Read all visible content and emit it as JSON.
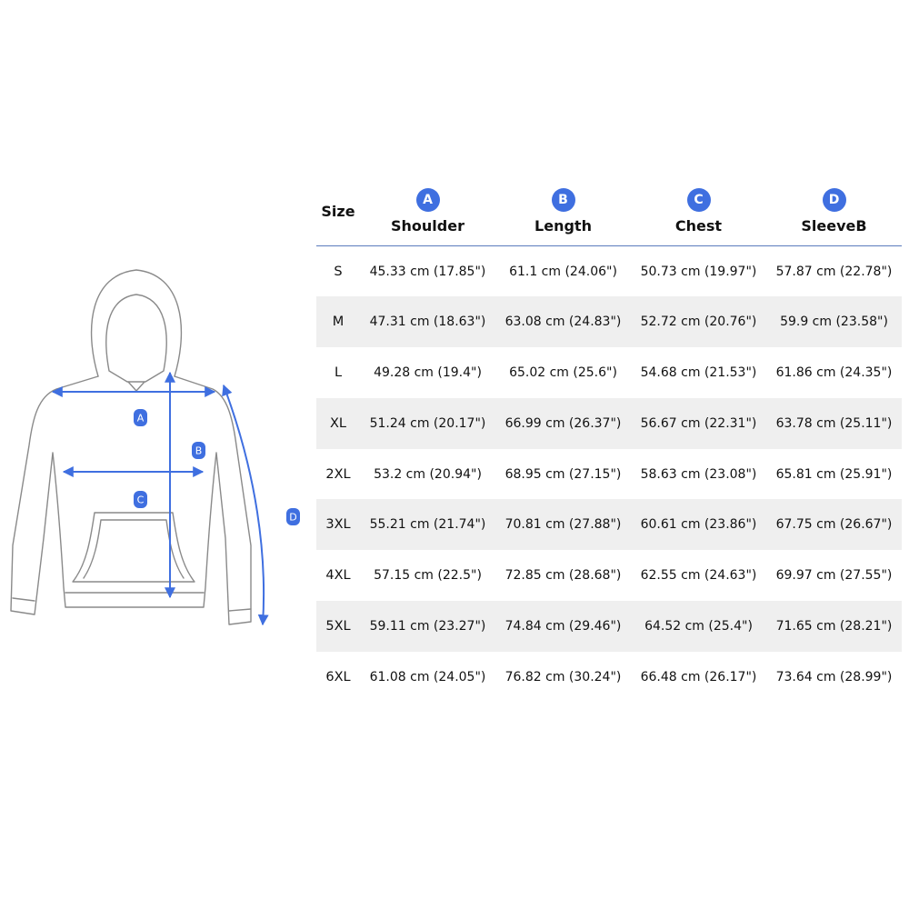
{
  "colors": {
    "accent": "#3f6fe0",
    "row_alt": "#efefef",
    "header_rule": "#5b7bbd"
  },
  "diagram": {
    "icon": "hoodie-outline-icon",
    "markers": {
      "a": "A",
      "b": "B",
      "c": "C",
      "d": "D"
    }
  },
  "table": {
    "size_header": "Size",
    "columns": [
      {
        "badge": "A",
        "label": "Shoulder"
      },
      {
        "badge": "B",
        "label": "Length"
      },
      {
        "badge": "C",
        "label": "Chest"
      },
      {
        "badge": "D",
        "label": "SleeveB"
      }
    ],
    "rows": [
      {
        "size": "S",
        "values": [
          "45.33 cm (17.85\")",
          "61.1 cm (24.06\")",
          "50.73 cm (19.97\")",
          "57.87 cm (22.78\")"
        ]
      },
      {
        "size": "M",
        "values": [
          "47.31 cm (18.63\")",
          "63.08 cm (24.83\")",
          "52.72 cm (20.76\")",
          "59.9 cm (23.58\")"
        ]
      },
      {
        "size": "L",
        "values": [
          "49.28 cm (19.4\")",
          "65.02 cm (25.6\")",
          "54.68 cm (21.53\")",
          "61.86 cm (24.35\")"
        ]
      },
      {
        "size": "XL",
        "values": [
          "51.24 cm (20.17\")",
          "66.99 cm (26.37\")",
          "56.67 cm (22.31\")",
          "63.78 cm (25.11\")"
        ]
      },
      {
        "size": "2XL",
        "values": [
          "53.2 cm (20.94\")",
          "68.95 cm (27.15\")",
          "58.63 cm (23.08\")",
          "65.81 cm (25.91\")"
        ]
      },
      {
        "size": "3XL",
        "values": [
          "55.21 cm (21.74\")",
          "70.81 cm (27.88\")",
          "60.61 cm (23.86\")",
          "67.75 cm (26.67\")"
        ]
      },
      {
        "size": "4XL",
        "values": [
          "57.15 cm (22.5\")",
          "72.85 cm (28.68\")",
          "62.55 cm (24.63\")",
          "69.97 cm (27.55\")"
        ]
      },
      {
        "size": "5XL",
        "values": [
          "59.11 cm (23.27\")",
          "74.84 cm (29.46\")",
          "64.52 cm (25.4\")",
          "71.65 cm (28.21\")"
        ]
      },
      {
        "size": "6XL",
        "values": [
          "61.08 cm (24.05\")",
          "76.82 cm (30.24\")",
          "66.48 cm (26.17\")",
          "73.64 cm (28.99\")"
        ]
      }
    ]
  }
}
